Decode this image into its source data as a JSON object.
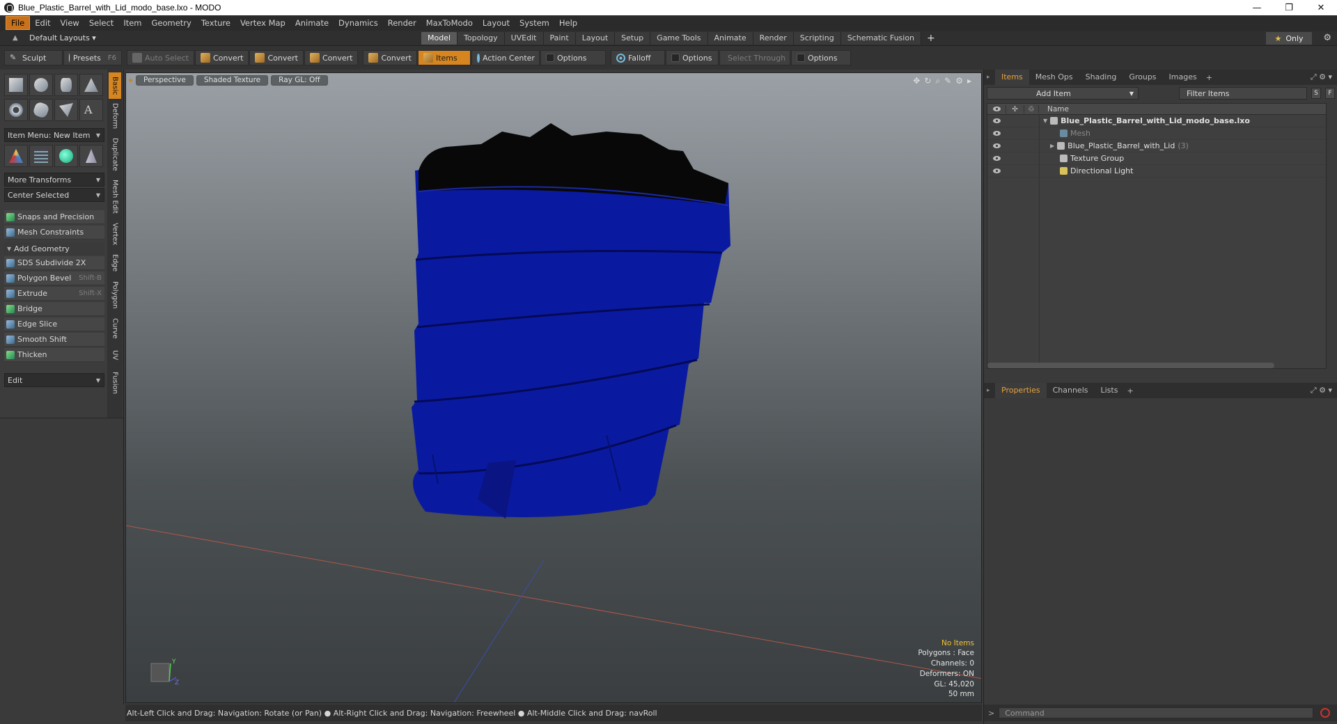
{
  "window": {
    "title": "Blue_Plastic_Barrel_with_Lid_modo_base.lxo - MODO",
    "minimize": "—",
    "maximize": "❐",
    "close": "✕"
  },
  "menubar": [
    "File",
    "Edit",
    "View",
    "Select",
    "Item",
    "Geometry",
    "Texture",
    "Vertex Map",
    "Animate",
    "Dynamics",
    "Render",
    "MaxToModo",
    "Layout",
    "System",
    "Help"
  ],
  "layoutbar": {
    "layouts_label": "Default Layouts ▾",
    "tabs": [
      "Model",
      "Topology",
      "UVEdit",
      "Paint",
      "Layout",
      "Setup",
      "Game Tools",
      "Animate",
      "Render",
      "Scripting",
      "Schematic Fusion"
    ],
    "active_tab": "Model",
    "only_label": "Only"
  },
  "toolbar": {
    "sculpt": "Sculpt",
    "presets": "Presets",
    "presets_shortcut": "F6",
    "auto_select": "Auto Select",
    "convert1": "Convert",
    "convert2": "Convert",
    "convert3": "Convert",
    "convert4": "Convert",
    "items": "Items",
    "action_center": "Action Center",
    "options1": "Options",
    "falloff": "Falloff",
    "options2": "Options",
    "select_through": "Select Through",
    "options3": "Options"
  },
  "leftpanel": {
    "vtabs": [
      "Basic",
      "Deform",
      "Duplicate",
      "Mesh Edit",
      "Vertex",
      "Edge",
      "Polygon",
      "Curve",
      "UV",
      "Fusion"
    ],
    "item_menu": "Item Menu: New Item",
    "more_transforms": "More Transforms",
    "center_selected": "Center Selected",
    "snaps": "Snaps and Precision",
    "mesh_constraints": "Mesh Constraints",
    "add_geometry": "Add Geometry",
    "tools": [
      {
        "label": "SDS Subdivide 2X",
        "shortcut": ""
      },
      {
        "label": "Polygon Bevel",
        "shortcut": "Shift-B"
      },
      {
        "label": "Extrude",
        "shortcut": "Shift-X"
      },
      {
        "label": "Bridge",
        "shortcut": ""
      },
      {
        "label": "Edge Slice",
        "shortcut": ""
      },
      {
        "label": "Smooth Shift",
        "shortcut": ""
      },
      {
        "label": "Thicken",
        "shortcut": ""
      }
    ],
    "edit": "Edit"
  },
  "viewport": {
    "view": "Perspective",
    "shading": "Shaded Texture",
    "raygl": "Ray GL: Off",
    "stats": {
      "items": "No Items",
      "polygons": "Polygons : Face",
      "channels": "Channels: 0",
      "deformers": "Deformers: ON",
      "gl": "GL: 45,020",
      "scale": "50 mm"
    },
    "axis_y": "Y",
    "axis_z": "Z",
    "colors": {
      "barrel": "#0a1aa0",
      "lid": "#080808"
    }
  },
  "statusbar": "Alt-Left Click and Drag: Navigation: Rotate (or Pan) ● Alt-Right Click and Drag: Navigation: Freewheel ● Alt-Middle Click and Drag: navRoll",
  "rightpanel": {
    "top_tabs": [
      "Items",
      "Mesh Ops",
      "Shading",
      "Groups",
      "Images"
    ],
    "active_top_tab": "Items",
    "add_item": "Add Item",
    "filter": "Filter Items",
    "btn_s": "S",
    "btn_f": "F",
    "tree_header": "Name",
    "tree": [
      {
        "label": "Blue_Plastic_Barrel_with_Lid_modo_base.lxo",
        "count": ""
      },
      {
        "label": "Mesh",
        "count": ""
      },
      {
        "label": "Blue_Plastic_Barrel_with_Lid",
        "count": "(3)"
      },
      {
        "label": "Texture Group",
        "count": ""
      },
      {
        "label": "Directional Light",
        "count": ""
      }
    ],
    "bottom_tabs": [
      "Properties",
      "Channels",
      "Lists"
    ],
    "active_bottom_tab": "Properties",
    "command_placeholder": "Command"
  }
}
